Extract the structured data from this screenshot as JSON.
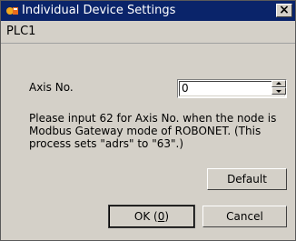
{
  "window": {
    "title": "Individual Device Settings"
  },
  "header": {
    "device": "PLC1"
  },
  "axis": {
    "label": "Axis No.",
    "value": "0"
  },
  "note": {
    "text": "Please input 62 for Axis No. when the node is Modbus Gateway mode of ROBONET. (This process sets \"adrs\" to \"63\".)"
  },
  "buttons": {
    "default": "Default",
    "ok_prefix": "OK (",
    "ok_mnemonic": "0",
    "ok_suffix": ")",
    "cancel": "Cancel"
  },
  "icons": {
    "app": "device-settings-icon",
    "close": "close-icon"
  }
}
